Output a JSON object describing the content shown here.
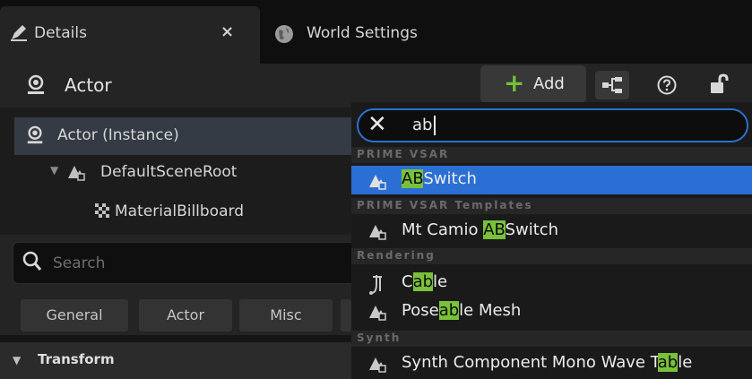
{
  "tabs": [
    {
      "label": "Details",
      "icon": "pencil-icon",
      "close_label": "×"
    },
    {
      "label": "World Settings",
      "icon": "globe-icon"
    }
  ],
  "header": {
    "title": "Actor",
    "add_label": "Add",
    "add_symbol": "+"
  },
  "tree": {
    "instance": "Actor (Instance)",
    "root": "DefaultSceneRoot",
    "child": "MaterialBillboard"
  },
  "search": {
    "placeholder": "Search"
  },
  "filters": [
    "General",
    "Actor",
    "Misc"
  ],
  "section": {
    "transform": "Transform"
  },
  "dropdown": {
    "query": "ab",
    "categories": [
      {
        "name": "PRIME VSAR",
        "items": [
          {
            "pre": "",
            "hl": "AB",
            "post": "Switch",
            "icon": "component-icon",
            "selected": true
          }
        ]
      },
      {
        "name": "PRIME VSAR Templates",
        "items": [
          {
            "pre": "Mt Camio ",
            "hl": "AB",
            "post": "Switch",
            "icon": "component-icon",
            "selected": false
          }
        ]
      },
      {
        "name": "Rendering",
        "items": [
          {
            "pre": "C",
            "hl": "ab",
            "post": "le",
            "icon": "cable-icon",
            "selected": false
          },
          {
            "pre": "Pose",
            "hl": "ab",
            "post": "le Mesh",
            "icon": "component-icon",
            "selected": false
          }
        ]
      },
      {
        "name": "Synth",
        "items": [
          {
            "pre": "Synth Component Mono Wave T",
            "hl": "ab",
            "post": "le",
            "icon": "component-icon",
            "selected": false
          }
        ]
      }
    ]
  },
  "colors": {
    "accent": "#2c6fd4",
    "highlight": "#79c13a",
    "add_green": "#73c13a"
  }
}
